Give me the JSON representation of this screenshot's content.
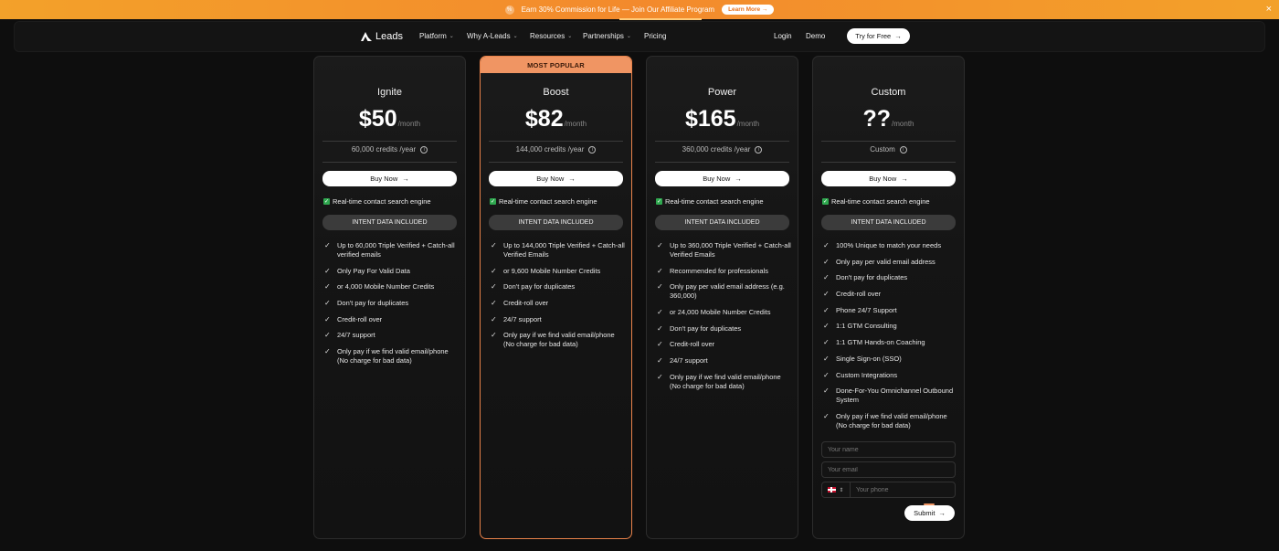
{
  "banner": {
    "text": "Earn 30% Commission for Life — Join Our Affiliate Program",
    "learn_more": "Learn More",
    "close": "×"
  },
  "nav": {
    "logo_text": "Leads",
    "items": [
      {
        "label": "Platform",
        "dropdown": true
      },
      {
        "label": "Why A-Leads",
        "dropdown": true
      },
      {
        "label": "Resources",
        "dropdown": true
      },
      {
        "label": "Partnerships",
        "dropdown": true
      },
      {
        "label": "Pricing",
        "dropdown": false
      }
    ],
    "login": "Login",
    "demo": "Demo",
    "try_free": "Try for Free"
  },
  "plans": [
    {
      "name": "Ignite",
      "price": "$50",
      "per": "/month",
      "credits": "60,000 credits /year",
      "buy": "Buy Now",
      "realtime": "Real-time contact search engine",
      "intent": "INTENT DATA INCLUDED",
      "features": [
        "Up to 60,000 Triple Verified + Catch-all verified emails",
        "Only Pay For Valid Data",
        "or 4,000 Mobile Number Credits",
        "Don't pay for duplicates",
        "Credit-roll over",
        "24/7 support",
        "Only pay if we find valid email/phone (No charge for bad data)"
      ]
    },
    {
      "name": "Boost",
      "badge": "MOST POPULAR",
      "price": "$82",
      "per": "/month",
      "credits": "144,000 credits /year",
      "buy": "Buy Now",
      "realtime": "Real-time contact search engine",
      "intent": "INTENT DATA INCLUDED",
      "features": [
        "Up to 144,000 Triple Verified + Catch-all Verified Emails",
        "or 9,600 Mobile Number Credits",
        "Don't pay for duplicates",
        "Credit-roll over",
        "24/7 support",
        "Only pay if we find valid email/phone (No charge for bad data)"
      ]
    },
    {
      "name": "Power",
      "price": "$165",
      "per": "/month",
      "credits": "360,000 credits /year",
      "buy": "Buy Now",
      "realtime": "Real-time contact search engine",
      "intent": "INTENT DATA INCLUDED",
      "features": [
        "Up to 360,000 Triple Verified + Catch-all Verified Emails",
        "Recommended for professionals",
        "Only pay per valid email address (e.g. 360,000)",
        "or 24,000 Mobile Number Credits",
        "Don't pay for duplicates",
        "Credit-roll over",
        "24/7 support",
        "Only pay if we find valid email/phone (No charge for bad data)"
      ]
    },
    {
      "name": "Custom",
      "price": "??",
      "per": "/month",
      "credits": "Custom",
      "buy": "Buy Now",
      "realtime": "Real-time contact search engine",
      "intent": "INTENT DATA INCLUDED",
      "features": [
        "100% Unique to match your needs",
        "Only pay per valid email address",
        "Don't pay for duplicates",
        "Credit-roll over",
        "Phone 24/7 Support",
        "1:1 GTM Consulting",
        "1:1 GTM Hands-on Coaching",
        "Single Sign-on (SSO)",
        "Custom Integrations",
        "Done-For-You Omnichannel Outbound System",
        "Only pay if we find valid email/phone (No charge for bad data)"
      ]
    }
  ],
  "form": {
    "name_placeholder": "Your name",
    "email_placeholder": "Your email",
    "phone_placeholder": "Your phone",
    "submit": "Submit"
  }
}
